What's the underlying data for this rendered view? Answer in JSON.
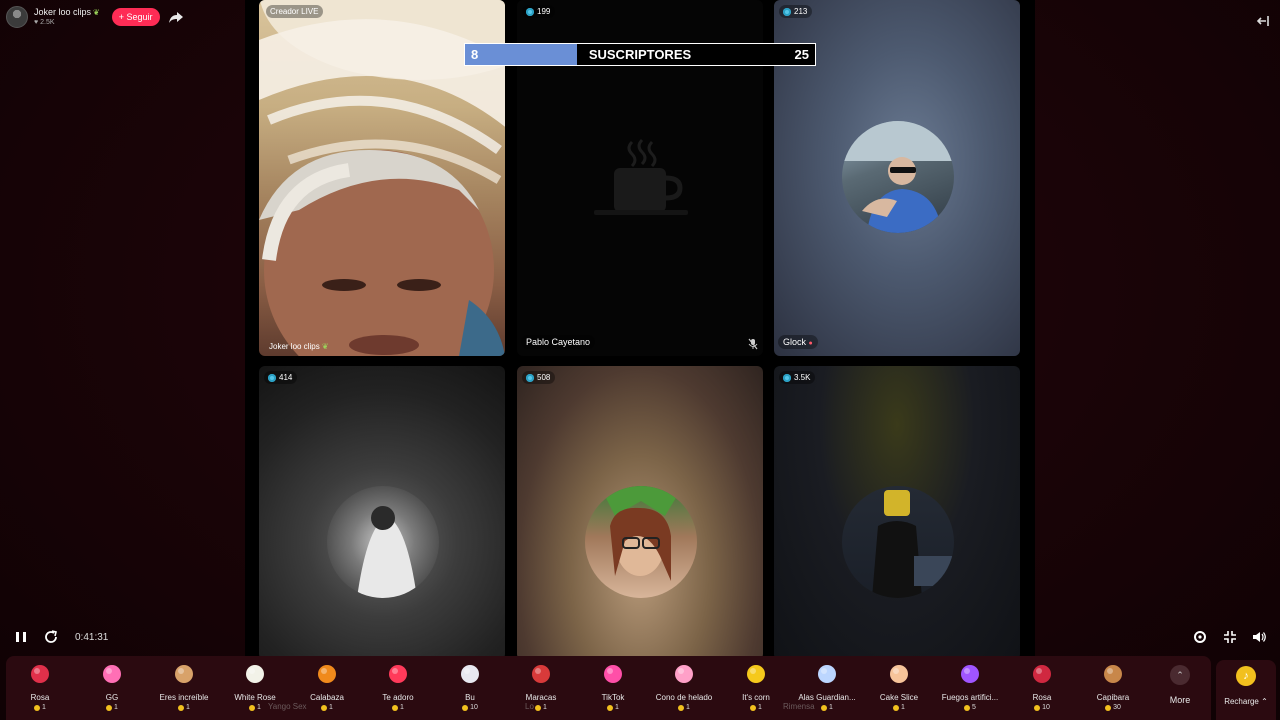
{
  "host": {
    "name": "Joker loo clips",
    "likes": "2.5K",
    "follow_label": "Seguir"
  },
  "subscribers": {
    "title": "SUSCRIPTORES",
    "left": "8",
    "right": "25",
    "progress": 0.32
  },
  "tiles": [
    {
      "badge": "Creador LIVE",
      "label": "Joker loo clips",
      "type": "video"
    },
    {
      "badge": "199",
      "label": "Pablo Cayetano",
      "type": "paused"
    },
    {
      "badge": "213",
      "label": "Glock",
      "type": "avatar"
    },
    {
      "badge": "414",
      "label": "Yango Sex",
      "type": "avatar"
    },
    {
      "badge": "508",
      "label": "Lo",
      "type": "avatar"
    },
    {
      "badge": "3.5K",
      "label": "Rimensa",
      "type": "avatar"
    }
  ],
  "player": {
    "time": "0:41:31"
  },
  "gifts": [
    {
      "name": "Rosa",
      "price": "1",
      "icon": "rose-icon",
      "color": "#e0304a"
    },
    {
      "name": "GG",
      "price": "1",
      "icon": "gg-icon",
      "color": "#ff6fb5"
    },
    {
      "name": "Eres increíble",
      "price": "1",
      "icon": "cat-icon",
      "color": "#d8a26a"
    },
    {
      "name": "White Rose",
      "price": "1",
      "icon": "white-rose-icon",
      "color": "#f2f2e8"
    },
    {
      "name": "Calabaza",
      "price": "1",
      "icon": "pumpkin-icon",
      "color": "#f08a1c"
    },
    {
      "name": "Te adoro",
      "price": "1",
      "icon": "heart-face-icon",
      "color": "#ff3a5a"
    },
    {
      "name": "Bu",
      "price": "10",
      "icon": "ghost-icon",
      "color": "#e8e8f0"
    },
    {
      "name": "Maracas",
      "price": "1",
      "icon": "maracas-icon",
      "color": "#d83a3a"
    },
    {
      "name": "TikTok",
      "price": "1",
      "icon": "tiktok-icon",
      "color": "#ff4fa8"
    },
    {
      "name": "Cono de helado",
      "price": "1",
      "icon": "ice-cream-icon",
      "color": "#ffa0c8"
    },
    {
      "name": "It's corn",
      "price": "1",
      "icon": "corn-icon",
      "color": "#f5c91c"
    },
    {
      "name": "Alas Guardian...",
      "price": "1",
      "icon": "wings-icon",
      "color": "#bcd6ff"
    },
    {
      "name": "Cake Slice",
      "price": "1",
      "icon": "cake-icon",
      "color": "#f7c49a"
    },
    {
      "name": "Fuegos artifici...",
      "price": "5",
      "icon": "fireworks-icon",
      "color": "#a055ff"
    },
    {
      "name": "Rosa",
      "price": "10",
      "icon": "rose-icon",
      "color": "#d02840"
    },
    {
      "name": "Capibara",
      "price": "30",
      "icon": "capybara-icon",
      "color": "#c8874a"
    }
  ],
  "more_label": "More",
  "recharge_label": "Recharge"
}
